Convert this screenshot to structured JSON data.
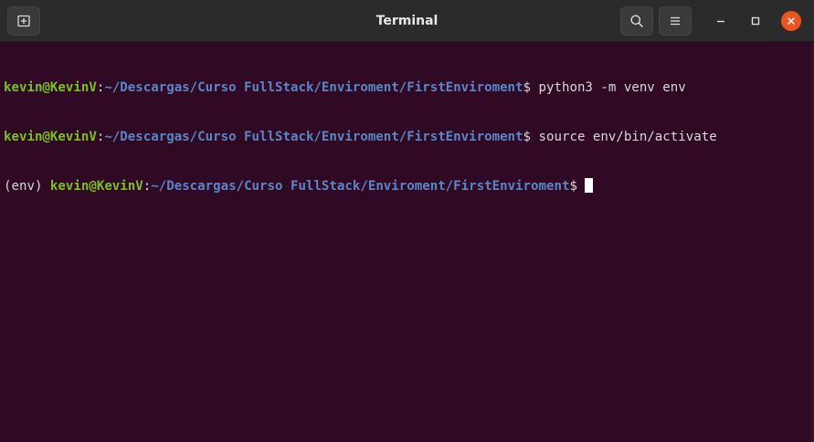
{
  "window": {
    "title": "Terminal"
  },
  "header": {
    "new_tab_icon": "new-tab-icon",
    "search_icon": "search-icon",
    "menu_icon": "hamburger-menu-icon",
    "minimize_icon": "minimize-icon",
    "maximize_icon": "maximize-icon",
    "close_icon": "close-icon"
  },
  "colors": {
    "terminal_bg": "#300a24",
    "user_host": "#7bbf24",
    "path": "#5a86c8",
    "text": "#d8d8d8",
    "close_button": "#e95420"
  },
  "terminal": {
    "lines": [
      {
        "prefix": "",
        "user": "kevin@KevinV",
        "colon": ":",
        "path": "~/Descargas/Curso FullStack/Enviroment/FirstEnviroment",
        "symbol": "$ ",
        "command": "python3 -m venv env"
      },
      {
        "prefix": "",
        "user": "kevin@KevinV",
        "colon": ":",
        "path": "~/Descargas/Curso FullStack/Enviroment/FirstEnviroment",
        "symbol": "$ ",
        "command": "source env/bin/activate"
      },
      {
        "prefix": "(env) ",
        "user": "kevin@KevinV",
        "colon": ":",
        "path": "~/Descargas/Curso FullStack/Enviroment/FirstEnviroment",
        "symbol": "$ ",
        "command": ""
      }
    ]
  }
}
